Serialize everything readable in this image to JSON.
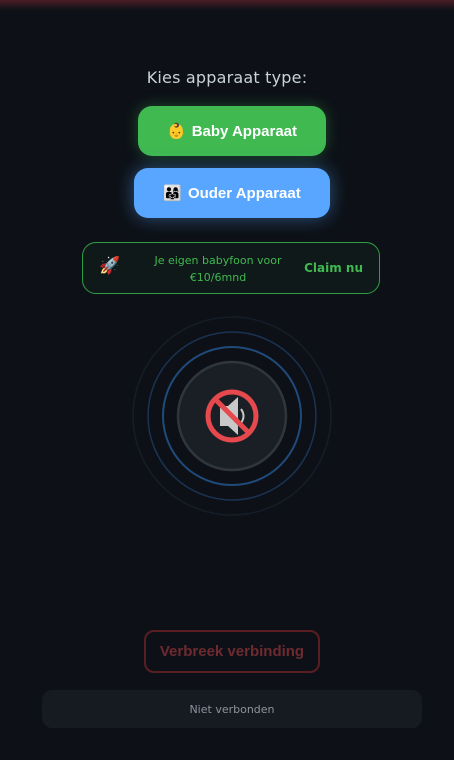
{
  "prompt": "Kies apparaat type:",
  "buttons": {
    "baby": {
      "icon": "baby-face-emoji",
      "glyph": "👶",
      "label": "Baby Apparaat",
      "color": "#3fb950"
    },
    "ouder": {
      "icon": "family-emoji",
      "glyph": "👨‍👩‍👧",
      "label": "Ouder Apparaat",
      "color": "#58a6ff"
    }
  },
  "promo": {
    "icon": "rocket-emoji",
    "glyph": "🚀",
    "text_line1": "Je eigen babyfoon voor",
    "text_line2": "€10/6mnd",
    "claim_label": "Claim nu",
    "color": "#3fb950"
  },
  "audio_indicator": {
    "icon": "muted-speaker-icon",
    "ring_color": "#1f4a7a",
    "state": "muted"
  },
  "disconnect_label": "Verbreek verbinding",
  "status_text": "Niet verbonden"
}
